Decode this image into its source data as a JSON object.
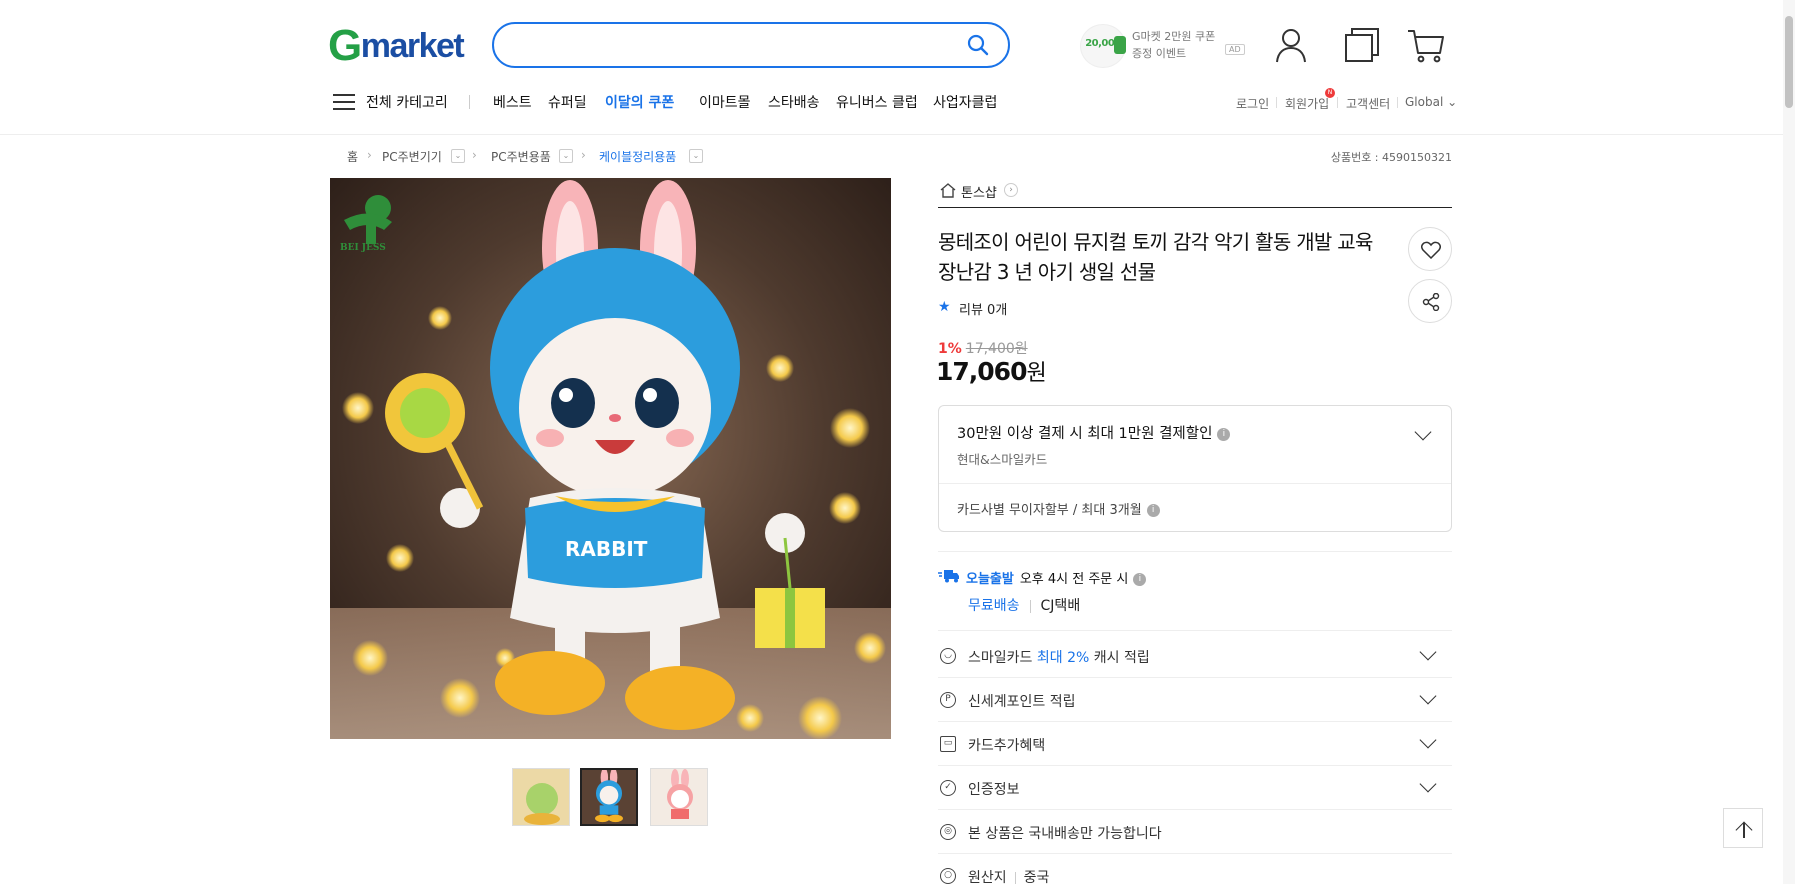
{
  "header": {
    "logo_g": "G",
    "logo_rest": "market",
    "search_placeholder": "",
    "promo_coin": "20,000",
    "promo_line1": "G마켓 2만원 쿠폰",
    "promo_line2": "증정 이벤트",
    "promo_ad": "AD"
  },
  "nav": {
    "all_categories": "전체 카테고리",
    "items": [
      "베스트",
      "슈퍼딜",
      "이달의 쿠폰",
      "이마트몰",
      "스타배송",
      "유니버스 클럽",
      "사업자클럽"
    ],
    "badge": "N",
    "util": [
      "로그인",
      "회원가입",
      "고객센터",
      "Global ⌄"
    ]
  },
  "breadcrumb": {
    "items": [
      "홈",
      "PC주변기기",
      "PC주변용품",
      "케이블정리용품"
    ],
    "product_no": "상품번호 : 4590150321"
  },
  "product": {
    "shop": "톤스샵",
    "title": "몽테조이 어린이 뮤지컬 토끼 감각 악기 활동 개발 교육 장난감 3 년 아기 생일 선물",
    "review": "리뷰 0개",
    "discount": "1%",
    "original_price": "17,400원",
    "price": "17,060",
    "price_unit": "원",
    "image_logo": "BEI JESS",
    "shirt_text": "RABBIT"
  },
  "card": {
    "title": "30만원 이상 결제 시 최대 1만원 결제할인",
    "sub": "현대&스마일카드",
    "install": "카드사별 무이자할부 / 최대 3개월"
  },
  "shipping": {
    "tag": "오늘출발",
    "cutoff": "오후 4시 전 주문 시",
    "free": "무료배송",
    "carrier": "CJ택배"
  },
  "rows": {
    "smile_pre": "스마일카드 ",
    "smile_hl": "최대 2%",
    "smile_post": " 캐시 적립",
    "point": "신세계포인트 적립",
    "card_extra": "카드추가혜택",
    "cert": "인증정보",
    "domestic": "본 상품은 국내배송만 가능합니다",
    "origin_label": "원산지",
    "origin_value": "중국"
  },
  "colors": {
    "accent": "#1a73e8",
    "logo_green": "#24a046",
    "discount_red": "#ee3a3a"
  }
}
